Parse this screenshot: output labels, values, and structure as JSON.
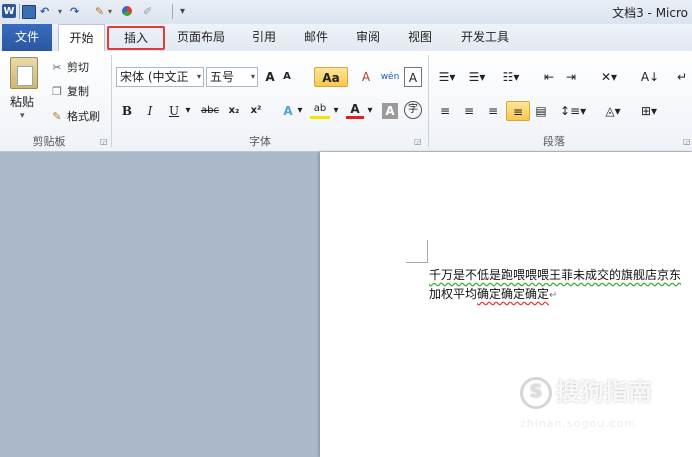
{
  "titlebar": {
    "logo": "W",
    "doc_title": "文档3 - Micro",
    "icons": [
      "word-logo-icon",
      "save-icon",
      "undo-icon",
      "redo-icon",
      "format-painter-icon",
      "color-icon",
      "pen-icon",
      "customize-caret-icon"
    ]
  },
  "tabs": {
    "file": "文件",
    "home": "开始",
    "insert": "插入",
    "layout": "页面布局",
    "references": "引用",
    "mailings": "邮件",
    "review": "审阅",
    "view": "视图",
    "developer": "开发工具"
  },
  "clipboard": {
    "paste": "粘贴",
    "cut": "剪切",
    "copy": "复制",
    "format_painter": "格式刷",
    "label": "剪贴板"
  },
  "font": {
    "name": "宋体 (中文正",
    "size": "五号",
    "grow": "A",
    "shrink": "A",
    "change_case": "Aa",
    "clear": "A",
    "phonetic": "wén",
    "wen": "文",
    "border": "A",
    "bold": "B",
    "italic": "I",
    "underline": "U",
    "strike": "abc",
    "subscript": "x₂",
    "superscript": "x²",
    "text_effect": "A",
    "highlight": "ab",
    "font_color": "A",
    "char_shading": "A",
    "enclose": "字",
    "label": "字体"
  },
  "paragraph": {
    "label": "段落",
    "sort": "A↓"
  },
  "document": {
    "line1": "千万是不低是跑喂喂喂王菲未成交的旗舰店京东",
    "line2_a": "加权平均",
    "line2_b": "确定确定确定",
    "para_mark": "↵"
  },
  "watermark": {
    "text": "搜狗指南",
    "sub": "zhinan.sogou.com",
    "glyph": "S"
  },
  "colors": {
    "file_tab": "#2a579f",
    "highlight_box": "#e23b3b",
    "workspace": "#abb8c9"
  }
}
